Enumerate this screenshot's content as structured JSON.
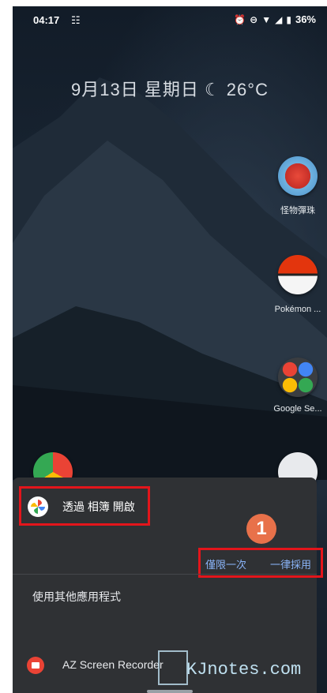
{
  "status_bar": {
    "time": "04:17",
    "battery": "36%"
  },
  "date_widget": {
    "text": "9月13日 星期日 ☾ 26°C"
  },
  "apps": [
    {
      "label": "怪物彈珠"
    },
    {
      "label": "Pokémon ..."
    },
    {
      "label": "Google Se..."
    }
  ],
  "sheet": {
    "open_with_label": "透過 相簿 開啟",
    "step_number": "1",
    "just_once": "僅限一次",
    "always": "一律採用",
    "other_apps_title": "使用其他應用程式",
    "other_app_label": "AZ Screen Recorder"
  },
  "watermark": {
    "text": "KJnotes.com"
  },
  "colors": {
    "highlight_border": "#e3151b",
    "action_text": "#8ab4f8",
    "step_badge": "#e8714a",
    "sheet_bg": "#2f3134"
  }
}
